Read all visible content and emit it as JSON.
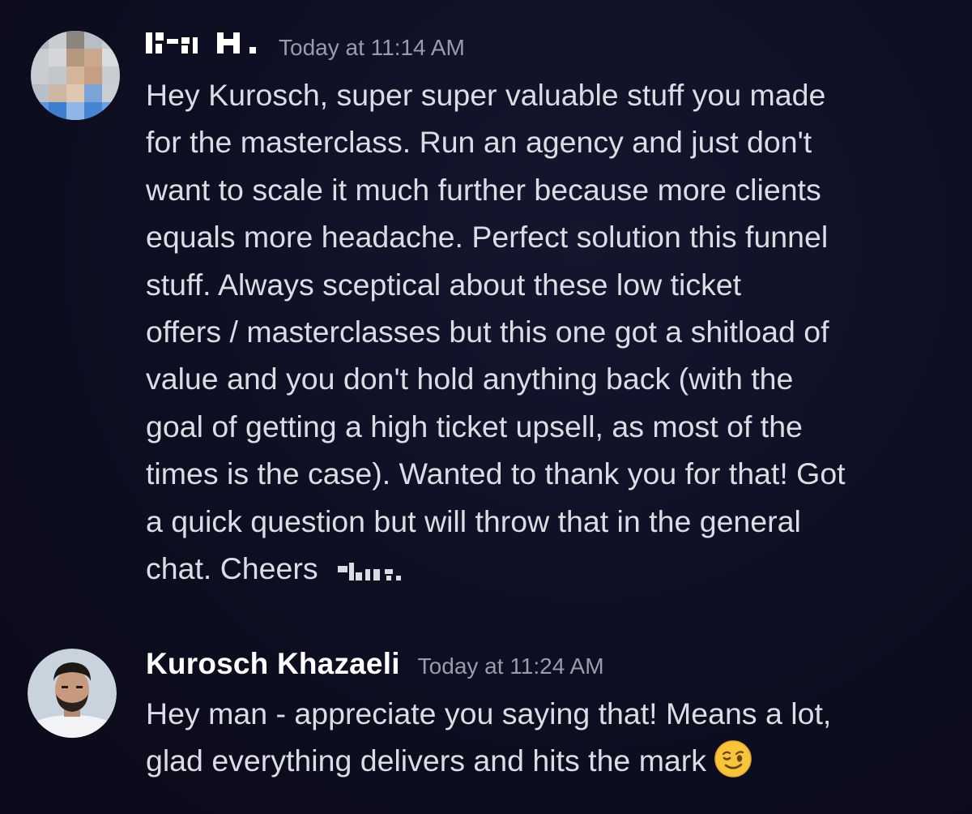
{
  "messages": [
    {
      "username": "",
      "username_redacted": true,
      "timestamp": "Today at 11:14 AM",
      "lines": [
        "Hey Kurosch, super super valuable stuff you made",
        "for the masterclass. Run an agency and just don't",
        "want to scale it much further because more clients",
        "equals more headache. Perfect solution this funnel",
        "stuff. Always sceptical about these low ticket",
        "offers / masterclasses but this one got a shitload of",
        "value and you don't hold anything back (with the",
        "goal of getting a high ticket upsell, as most of the",
        "times is the case). Wanted to thank you for that! Got",
        "a quick question but will throw that in the general",
        "chat. Cheers"
      ],
      "signature_redacted": true
    },
    {
      "username": "Kurosch Khazaeli",
      "timestamp": "Today at 11:24 AM",
      "lines": [
        "Hey man - appreciate you saying that! Means a lot,",
        "glad everything delivers and hits the mark"
      ],
      "emoji": "winking-face-icon"
    }
  ],
  "colors": {
    "background": "#0e0e22",
    "username": "#ffffff",
    "timestamp": "#9a9caa",
    "text": "#dcdde3"
  }
}
